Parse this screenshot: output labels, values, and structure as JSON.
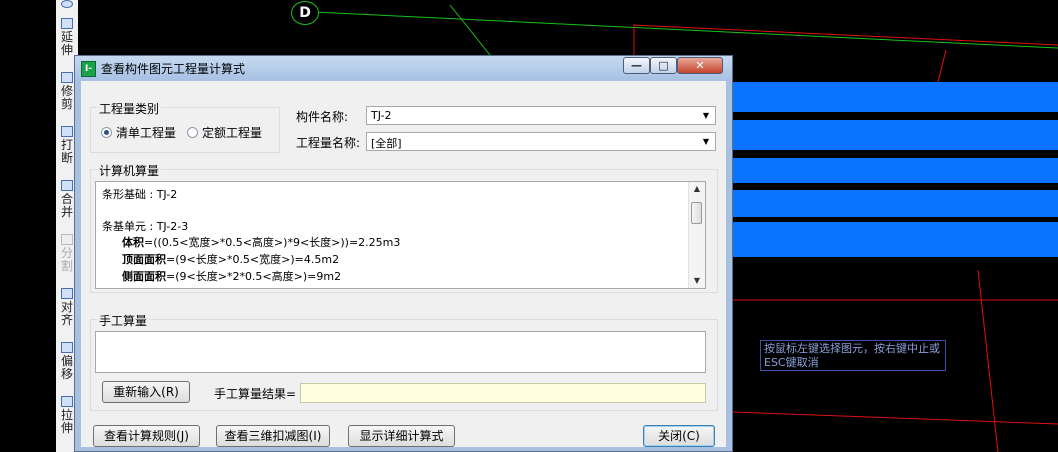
{
  "left_toolbar": {
    "items": [
      "延伸",
      "修剪",
      "打断",
      "合并",
      "分割",
      "对齐",
      "偏移",
      "拉伸"
    ]
  },
  "canvas": {
    "axis_label": "D",
    "hint_text": "按鼠标左键选择图元，按右键中止或ESC键取消",
    "colors": {
      "background": "#000000",
      "strip": "#0a73ff",
      "grid_red": "#e01010",
      "axis_green": "#19c219"
    }
  },
  "dialog": {
    "title": "查看构件图元工程量计算式",
    "title_buttons": {
      "minimize": "minimize-icon",
      "maximize": "maximize-icon",
      "close": "close-icon"
    },
    "quantity_type": {
      "group_label": "工程量类别",
      "options": [
        {
          "label": "清单工程量",
          "selected": true
        },
        {
          "label": "定额工程量",
          "selected": false
        }
      ]
    },
    "component_name": {
      "label": "构件名称:",
      "value": "TJ-2"
    },
    "quantity_name": {
      "label": "工程量名称:",
      "value": "[全部]"
    },
    "computer_calc": {
      "group_label": "计算机算量",
      "lines": {
        "l1": "条形基础 : TJ-2",
        "l2": "条基单元 : TJ-2-3",
        "l3_label": "体积",
        "l3_value": "=((0.5<宽度>*0.5<高度>)*9<长度>))=2.25m3",
        "l4_label": "顶面面积",
        "l4_value": "=(9<长度>*0.5<宽度>)=4.5m2",
        "l5_label": "侧面面积",
        "l5_value": "=(9<长度>*2*0.5<高度>)=9m2"
      }
    },
    "manual_calc": {
      "group_label": "手工算量",
      "input_value": "",
      "reenter_button": "重新输入(R)",
      "result_label": "手工算量结果=",
      "result_value": ""
    },
    "buttons": {
      "view_rules": "查看计算规则(J)",
      "view_3d": "查看三维扣减图(I)",
      "show_detail": "显示详细计算式",
      "close": "关闭(C)"
    }
  }
}
